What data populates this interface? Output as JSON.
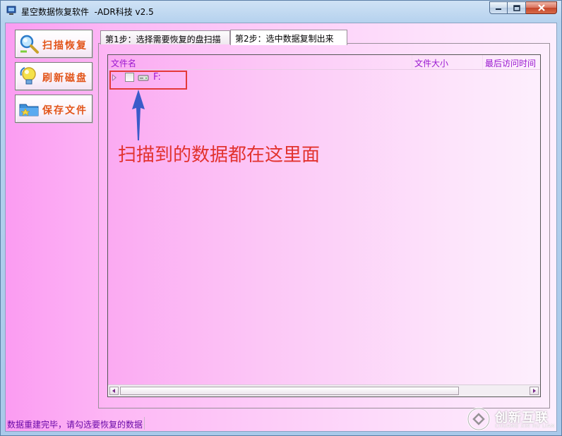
{
  "window": {
    "title": "星空数据恢复软件  -ADR科技 v2.5",
    "icon": "app-monitor-icon"
  },
  "window_controls": {
    "minimize_icon": "minimize-icon",
    "maximize_icon": "maximize-icon",
    "close_icon": "close-icon"
  },
  "sidebar": {
    "buttons": [
      {
        "label": "扫描恢复",
        "icon": "magnifier-icon"
      },
      {
        "label": "刷新磁盘",
        "icon": "refresh-bulb-icon"
      },
      {
        "label": "保存文件",
        "icon": "save-folder-icon"
      }
    ]
  },
  "tabs": [
    {
      "label": "第1步：选择需要恢复的盘扫描",
      "selected": false
    },
    {
      "label": "第2步：选中数据复制出来",
      "selected": true
    }
  ],
  "file_list": {
    "columns": [
      "文件名",
      "文件大小",
      "最后访问时间"
    ],
    "rows": [
      {
        "label": "F:",
        "checked": false,
        "icon": "drive-icon",
        "expanded": false
      }
    ]
  },
  "annotation": {
    "text": "扫描到的数据都在这里面",
    "color": "#e2322e"
  },
  "status_bar": {
    "message": "数据重建完毕，请勾选要恢复的数据"
  },
  "watermark": {
    "text": "创新互联",
    "sub": "CHUANG XIN HU LIAN"
  },
  "colors": {
    "accent_text": "#9a1ad0",
    "button_label": "#e2551a",
    "annotation_box": "#e43a3a",
    "background_pink": "#fb9cf2"
  }
}
